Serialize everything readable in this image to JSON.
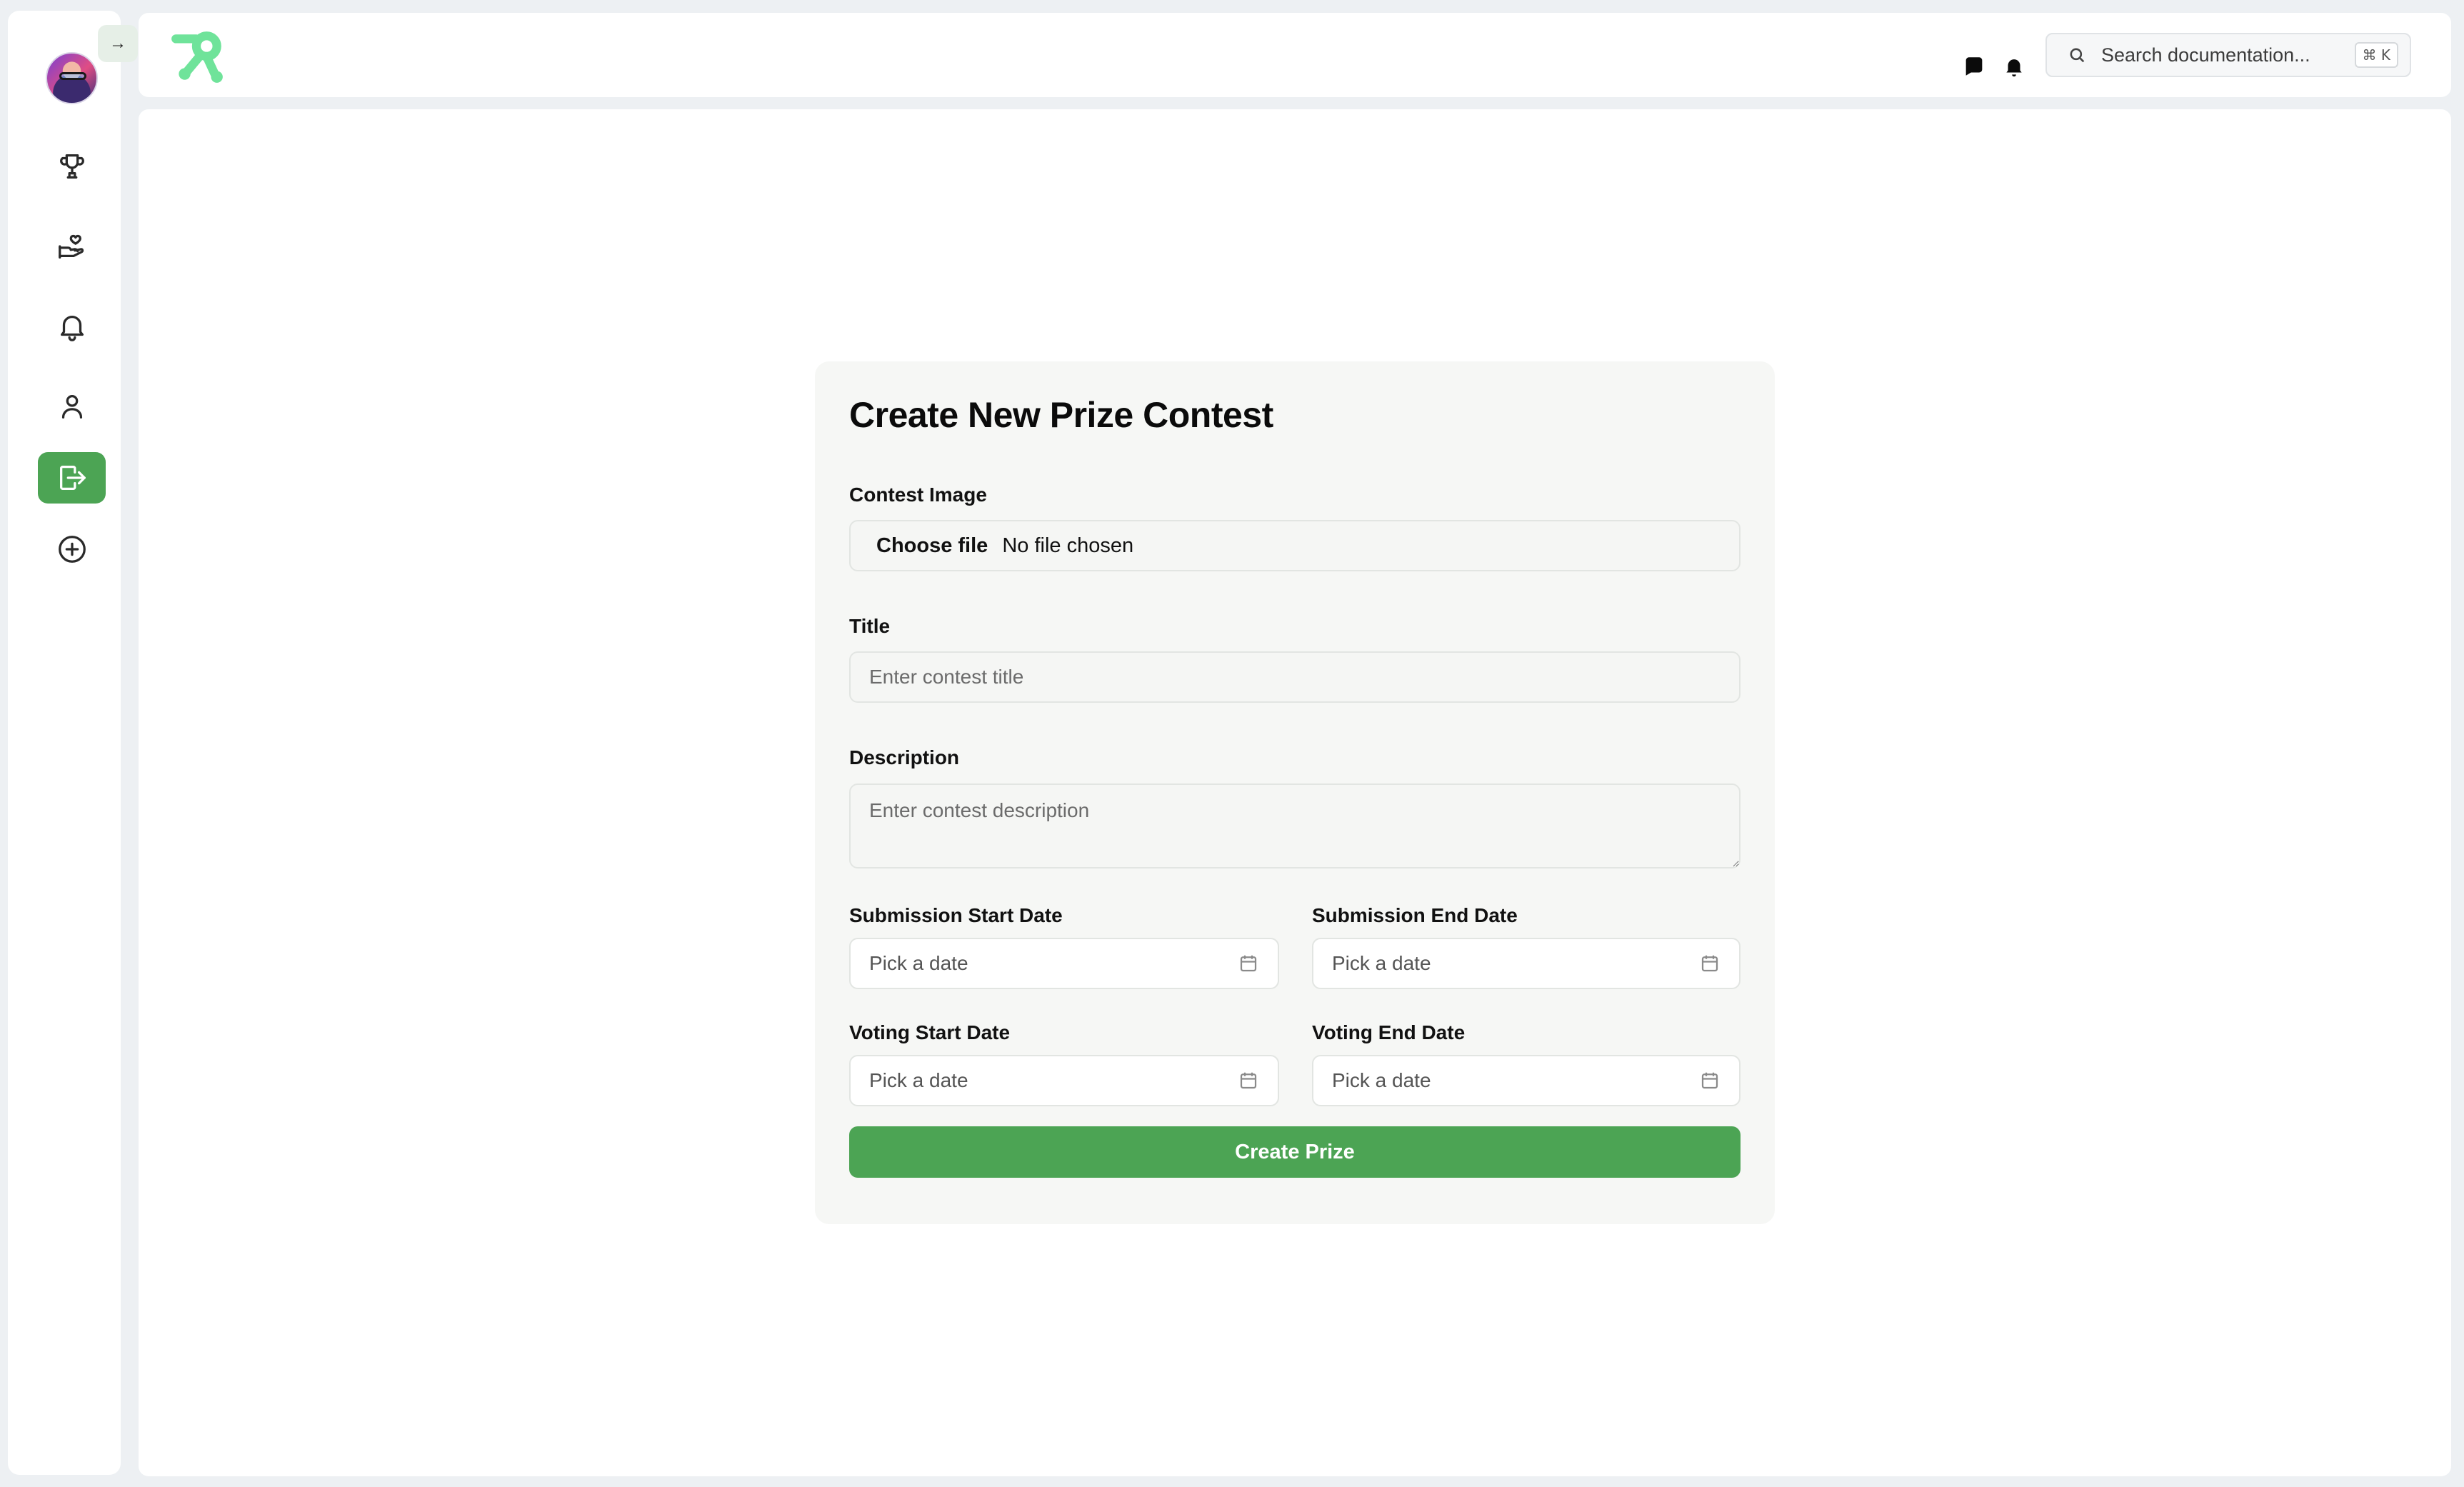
{
  "sidebar": {
    "collapse_label": "→",
    "items": [
      {
        "name": "contests",
        "icon": "trophy-icon",
        "active": false
      },
      {
        "name": "donations",
        "icon": "hand-heart-icon",
        "active": false
      },
      {
        "name": "notifications",
        "icon": "bell-icon",
        "active": false
      },
      {
        "name": "profile",
        "icon": "user-icon",
        "active": false
      },
      {
        "name": "logout",
        "icon": "logout-icon",
        "active": true
      },
      {
        "name": "create",
        "icon": "plus-circle-icon",
        "active": false
      }
    ]
  },
  "header": {
    "search_placeholder": "Search documentation...",
    "search_shortcut": "⌘ K"
  },
  "form": {
    "title": "Create New Prize Contest",
    "image_label": "Contest Image",
    "file_button": "Choose file",
    "file_status": "No file chosen",
    "title_label": "Title",
    "title_placeholder": "Enter contest title",
    "description_label": "Description",
    "description_placeholder": "Enter contest description",
    "submission_start_label": "Submission Start Date",
    "submission_end_label": "Submission End Date",
    "voting_start_label": "Voting Start Date",
    "voting_end_label": "Voting End Date",
    "date_placeholder": "Pick a date",
    "submit_label": "Create Prize"
  },
  "colors": {
    "accent": "#4ca454",
    "logo": "#6fe39a",
    "background": "#edf0f3"
  }
}
